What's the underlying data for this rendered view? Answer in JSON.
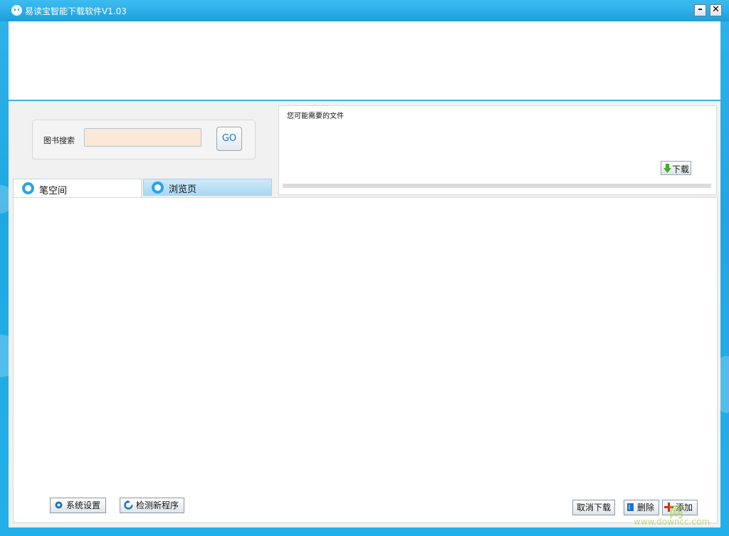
{
  "window": {
    "title": "易读宝智能下载软件V1.03",
    "minimize_label": "–",
    "close_label": "✕"
  },
  "search": {
    "label": "图书搜索",
    "value": "",
    "placeholder": "",
    "go_label": "GO"
  },
  "tabs": [
    {
      "label": "笔空间",
      "active": true
    },
    {
      "label": "浏览页",
      "active": false
    }
  ],
  "files_panel": {
    "title": "您可能需要的文件",
    "download_label": "下载",
    "progress": 0
  },
  "toolbar": {
    "settings_label": "系统设置",
    "update_label": "检测新程序",
    "cancel_label": "取消下载",
    "delete_label": "删除",
    "add_label": "添加"
  },
  "watermark": {
    "logo": "网",
    "url": "www.downcc.com"
  },
  "colors": {
    "accent": "#1fa7e4",
    "search_input_bg": "#fbe8d8",
    "go_text": "#1b78c4"
  }
}
